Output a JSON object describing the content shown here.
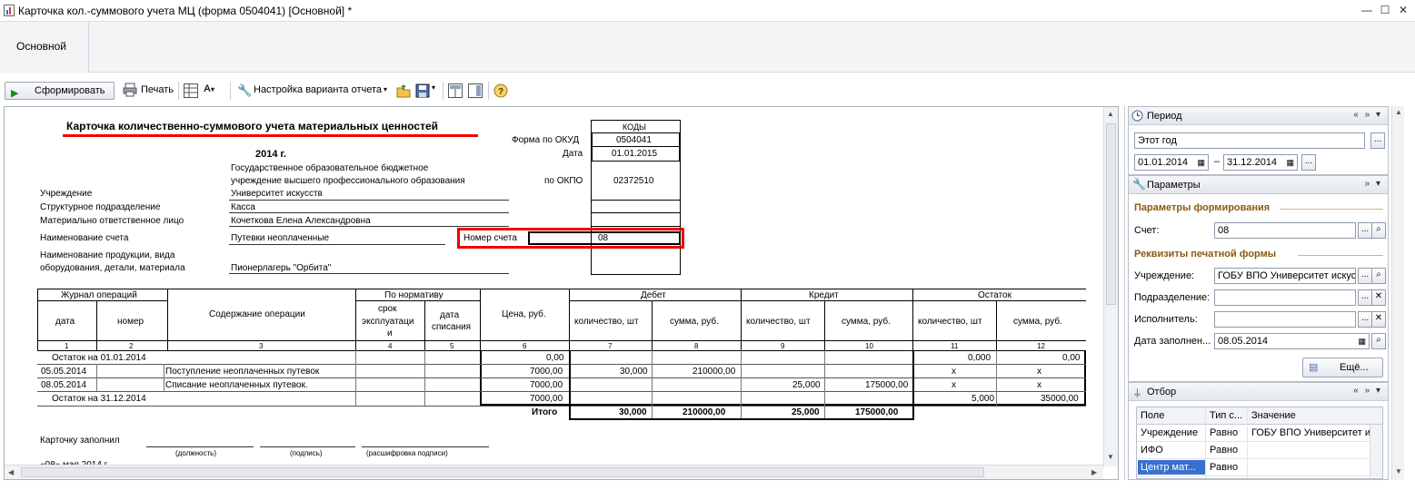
{
  "window": {
    "title": "Карточка кол.-суммового учета МЦ (форма 0504041) [Основной] *"
  },
  "tabs": {
    "main": "Основной"
  },
  "toolbar": {
    "generate": "Сформировать",
    "print": "Печать",
    "settings": "Настройка варианта отчета"
  },
  "report": {
    "title": "Карточка количественно-суммового учета материальных ценностей",
    "year": "2014 г.",
    "codes_header": "КОДЫ",
    "okud_label": "Форма по ОКУД",
    "okud_value": "0504041",
    "date_label": "Дата",
    "date_value": "01.01.2015",
    "okpo_label": "по ОКПО",
    "okpo_value": "02372510",
    "institution_label": "Учреждение",
    "institution_value_1": "Государственное образовательное бюджетное",
    "institution_value_2": "учреждение высшего профессионального образования",
    "institution_value_3": "Университет искусств",
    "division_label": "Структурное подразделение",
    "division_value": "Касса",
    "responsible_label": "Материально ответственное лицо",
    "responsible_value": "Кочеткова Елена Александровна",
    "account_name_label": "Наименование счета",
    "account_name_value": "Путевки неоплаченные",
    "account_number_label": "Номер счета",
    "account_number_value": "08",
    "product_label_1": "Наименование продукции, вида",
    "product_label_2": "оборудования, детали, материала",
    "product_value": "Пионерлагерь \"Орбита\"",
    "table": {
      "journal": "Журнал операций",
      "date": "дата",
      "number": "номер",
      "content": "Содержание операции",
      "normative": "По нормативу",
      "term_1": "срок",
      "term_2": "эксплуатаци",
      "term_3": "и",
      "writeoff_1": "дата",
      "writeoff_2": "списания",
      "price": "Цена, руб.",
      "debit": "Дебет",
      "credit": "Кредит",
      "balance": "Остаток",
      "qty": "количество, шт",
      "sum": "сумма, руб.",
      "col_numbers": [
        "1",
        "2",
        "3",
        "4",
        "5",
        "6",
        "7",
        "8",
        "9",
        "10",
        "11",
        "12"
      ],
      "opening": {
        "label": "Остаток на 01.01.2014",
        "price": "0,00",
        "bal_qty": "0,000",
        "bal_sum": "0,00"
      },
      "rows": [
        {
          "date": "05.05.2014",
          "content": "Поступление неоплаченных путевок",
          "price": "7000,00",
          "d_qty": "30,000",
          "d_sum": "210000,00",
          "c_qty": "",
          "c_sum": "",
          "b_qty": "x",
          "b_sum": "x"
        },
        {
          "date": "08.05.2014",
          "content": "Списание неоплаченных путевок.",
          "price": "7000,00",
          "d_qty": "",
          "d_sum": "",
          "c_qty": "25,000",
          "c_sum": "175000,00",
          "b_qty": "x",
          "b_sum": "x"
        }
      ],
      "closing": {
        "label": "Остаток на 31.12.2014",
        "price": "7000,00",
        "bal_qty": "5,000",
        "bal_sum": "35000,00"
      },
      "total": {
        "label": "Итого",
        "d_qty": "30,000",
        "d_sum": "210000,00",
        "c_qty": "25,000",
        "c_sum": "175000,00"
      }
    },
    "filled_by": "Карточку заполнил",
    "position": "(должность)",
    "signature": "(подпись)",
    "decoding": "(расшифровка подписи)",
    "date_footer": "«08» мая 2014 г."
  },
  "period_panel": {
    "header": "Период",
    "preset": "Этот год",
    "date_from": "01.01.2014",
    "dash": "–",
    "date_to": "31.12.2014"
  },
  "params_panel": {
    "header": "Параметры",
    "section_gen": "Параметры формирования",
    "account_label": "Счет:",
    "account_value": "08",
    "section_print": "Реквизиты печатной формы",
    "institution_label": "Учреждение:",
    "institution_value": "ГОБУ ВПО Университет искусс",
    "division_label": "Подразделение:",
    "executor_label": "Исполнитель:",
    "fill_date_label": "Дата заполнен...",
    "fill_date_value": "08.05.2014",
    "more_button": "Ещё..."
  },
  "filter_panel": {
    "header": "Отбор",
    "columns": [
      "Поле",
      "Тип с...",
      "Значение"
    ],
    "rows": [
      {
        "field": "Учреждение",
        "type": "Равно",
        "value": "ГОБУ ВПО Университет и"
      },
      {
        "field": "ИФО",
        "type": "Равно",
        "value": ""
      },
      {
        "field": "Центр мат...",
        "type": "Равно",
        "value": ""
      }
    ]
  },
  "colors": {
    "accent_red": "#e00000",
    "section_brown": "#8a5a10",
    "selection_blue": "#3a6fd0"
  }
}
